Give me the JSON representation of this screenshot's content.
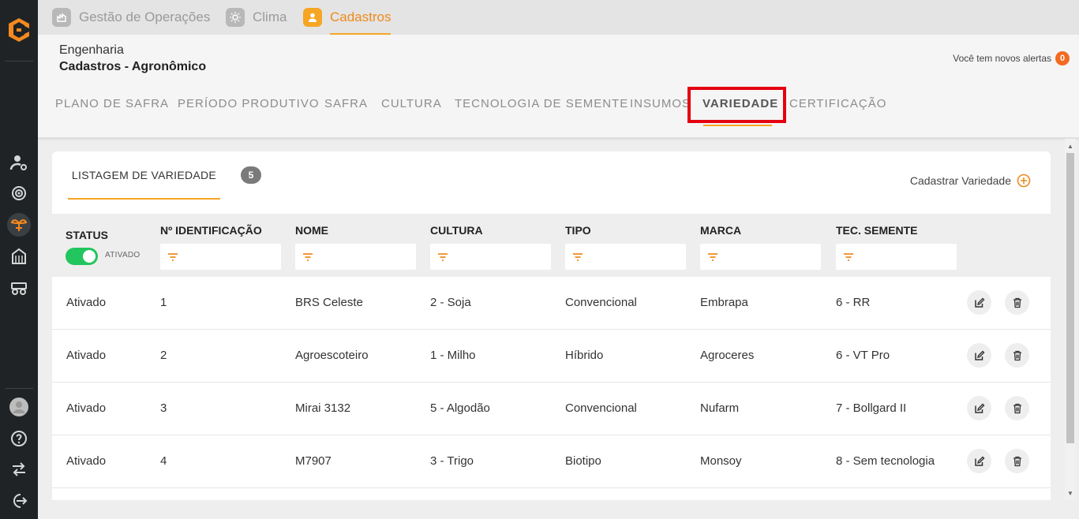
{
  "top_tabs": [
    {
      "label": "Gestão de Operações",
      "icon": "operations-icon"
    },
    {
      "label": "Clima",
      "icon": "sun-icon"
    },
    {
      "label": "Cadastros",
      "icon": "user-icon"
    }
  ],
  "header": {
    "breadcrumb_parent": "Engenharia",
    "page_title": "Cadastros - Agronômico",
    "alert_text": "Você tem novos alertas",
    "alert_count": "0"
  },
  "subnav": [
    "PLANO DE SAFRA",
    "PERÍODO PRODUTIVO",
    "SAFRA",
    "CULTURA",
    "TECNOLOGIA DE SEMENTE",
    "INSUMOS",
    "VARIEDADE",
    "CERTIFICAÇÃO"
  ],
  "listing": {
    "tab_label": "LISTAGEM DE VARIEDADE",
    "count": "5",
    "register_label": "Cadastrar Variedade"
  },
  "table": {
    "columns": {
      "status": "STATUS",
      "id": "Nº IDENTIFICAÇÃO",
      "nome": "NOME",
      "cultura": "CULTURA",
      "tipo": "TIPO",
      "marca": "MARCA",
      "tec": "TEC. SEMENTE"
    },
    "status_filter_label": "ATIVADO",
    "rows": [
      {
        "status": "Ativado",
        "id": "1",
        "nome": "BRS Celeste",
        "cultura": "2 - Soja",
        "tipo": "Convencional",
        "marca": "Embrapa",
        "tec": "6 - RR"
      },
      {
        "status": "Ativado",
        "id": "2",
        "nome": "Agroescoteiro",
        "cultura": "1 - Milho",
        "tipo": "Híbrido",
        "marca": "Agroceres",
        "tec": "6 - VT Pro"
      },
      {
        "status": "Ativado",
        "id": "3",
        "nome": "Mirai 3132",
        "cultura": "5 - Algodão",
        "tipo": "Convencional",
        "marca": "Nufarm",
        "tec": "7 - Bollgard II"
      },
      {
        "status": "Ativado",
        "id": "4",
        "nome": "M7907",
        "cultura": "3 - Trigo",
        "tipo": "Biotipo",
        "marca": "Monsoy",
        "tec": "8 - Sem tecnologia"
      }
    ]
  },
  "colors": {
    "accent": "#f6a623",
    "sidebar": "#1f2326",
    "toggle_on": "#22c55e",
    "highlight": "#e4000f"
  }
}
